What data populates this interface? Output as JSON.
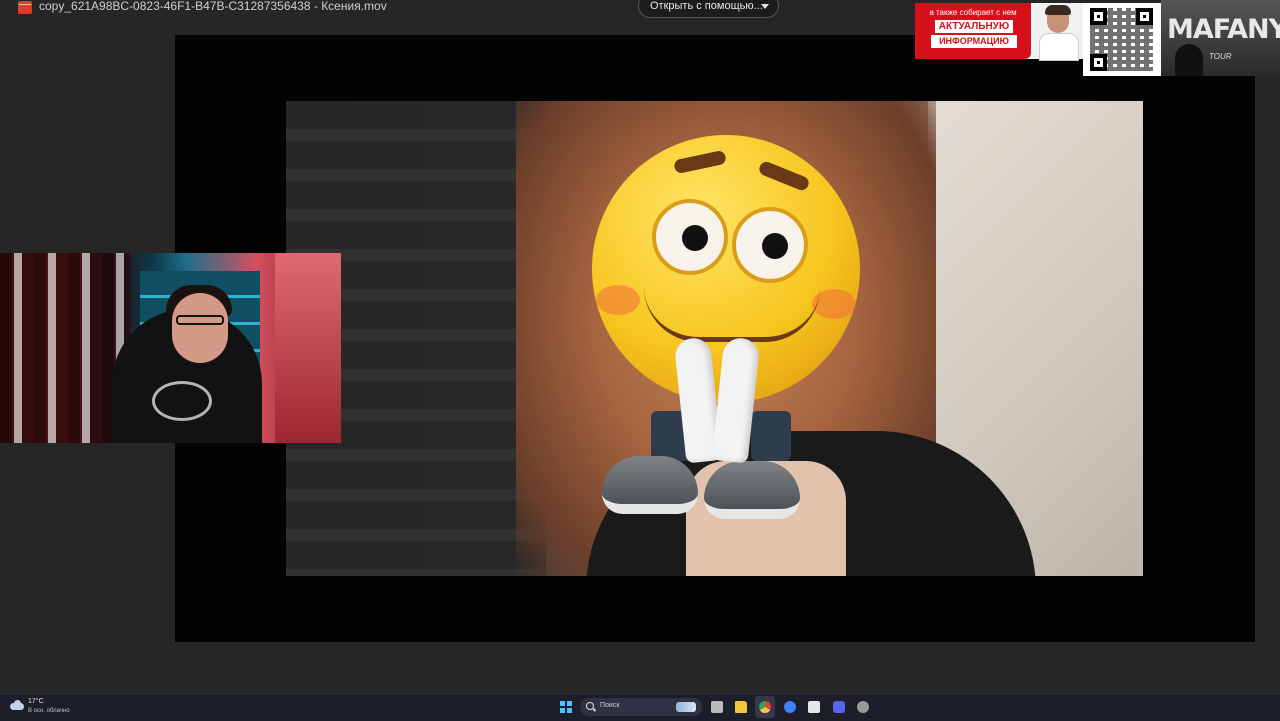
{
  "window": {
    "title": "copy_621A98BC-0823-46F1-B47B-C31287356438 - Ксения.mov",
    "open_with_label": "Открыть с помощью...",
    "file_icon": "movie-file-icon"
  },
  "overlay": {
    "ad_banner": {
      "line1": "а также собирает с нем",
      "line2": "АКТУАЛЬНУЮ",
      "line3": "ИНФОРМАЦИЮ"
    },
    "tour": {
      "title": "MAFANYA",
      "subtitle": "TOUR"
    }
  },
  "taskbar": {
    "weather_temp": "17°C",
    "weather_desc": "В осн. облачно",
    "search_placeholder": "Поиск",
    "icons": [
      "windows-start-icon",
      "task-view-icon",
      "file-explorer-icon",
      "chrome-icon",
      "browser-icon",
      "app-icon",
      "discord-icon",
      "settings-icon"
    ],
    "accent": "#4cc2ff"
  }
}
